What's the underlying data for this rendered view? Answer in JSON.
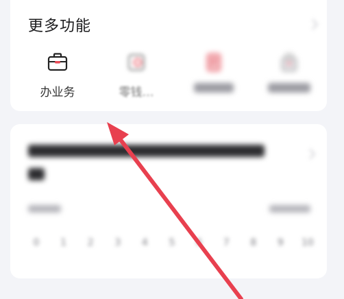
{
  "more_functions": {
    "title": "更多功能",
    "items": [
      {
        "label": "办业务",
        "icon": "briefcase-icon"
      },
      {
        "label": "零钱…",
        "icon": "wallet-icon"
      },
      {
        "label": "",
        "icon": "document-icon"
      },
      {
        "label": "",
        "icon": "bag-icon"
      }
    ]
  },
  "survey": {
    "scale": [
      "0",
      "1",
      "2",
      "3",
      "4",
      "5",
      "6",
      "7",
      "8",
      "9",
      "10"
    ]
  },
  "colors": {
    "arrow": "#e8404f",
    "accent_red": "#e94b57",
    "background": "#f3f4f8"
  }
}
